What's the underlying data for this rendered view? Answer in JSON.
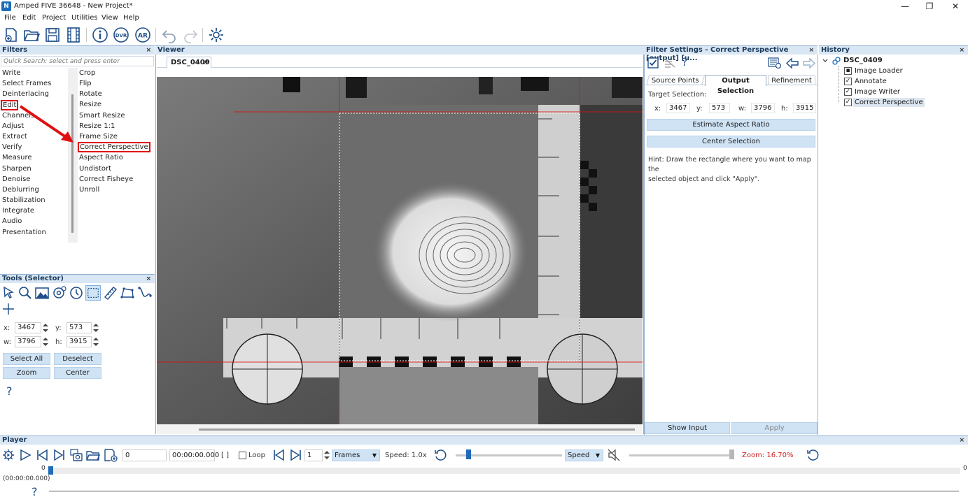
{
  "window": {
    "title": "Amped FIVE 36648 - New Project*",
    "logo_text": "N",
    "minimize": "—",
    "restore": "❐",
    "close": "✕"
  },
  "menu": [
    "File",
    "Edit",
    "Project",
    "Utilities",
    "View",
    "Help"
  ],
  "toolbar_icons": [
    "new-project-icon",
    "open-folder-icon",
    "save-icon",
    "film-icon",
    "info-icon",
    "dvr-icon",
    "ar-icon",
    "undo-icon",
    "redo-icon",
    "settings-icon"
  ],
  "filters": {
    "title": "Filters",
    "close": "×",
    "search_placeholder": "Quick Search: select and press enter",
    "categories": [
      "Write",
      "Select Frames",
      "Deinterlacing",
      "Edit",
      "Channels",
      "Adjust",
      "Extract",
      "Verify",
      "Measure",
      "Sharpen",
      "Denoise",
      "Deblurring",
      "Stabilization",
      "Integrate",
      "Audio",
      "Presentation"
    ],
    "items": [
      "Crop",
      "Flip",
      "Rotate",
      "Resize",
      "Smart Resize",
      "Resize 1:1",
      "Frame Size",
      "Correct Perspective",
      "Aspect Ratio",
      "Undistort",
      "Correct Fisheye",
      "Unroll"
    ]
  },
  "tools": {
    "title": "Tools (Selector)",
    "close": "×",
    "icons": [
      "pointer-icon",
      "zoom-icon",
      "image-icon",
      "target-icon",
      "clock-icon",
      "rect-select-icon",
      "ruler-icon",
      "polygon-icon",
      "curve-icon",
      "crosshair-icon"
    ],
    "x_label": "x:",
    "x_value": "3467",
    "y_label": "y:",
    "y_value": "573",
    "w_label": "w:",
    "w_value": "3796",
    "h_label": "h:",
    "h_value": "3915",
    "select_all": "Select All",
    "deselect": "Deselect",
    "zoom": "Zoom",
    "center": "Center",
    "help": "?"
  },
  "viewer": {
    "title": "Viewer",
    "tab": "DSC_0409",
    "tab_close": "×"
  },
  "filter_settings": {
    "title": "Filter Settings - Correct Perspective [output] [u...",
    "close": "×",
    "help": "?",
    "tabs": [
      "Source Points",
      "Output Selection",
      "Refinement"
    ],
    "target_selection": "Target Selection:",
    "x_label": "x:",
    "x_value": "3467",
    "y_label": "y:",
    "y_value": "573",
    "w_label": "w:",
    "w_value": "3796",
    "h_label": "h:",
    "h_value": "3915",
    "estimate_aspect_ratio": "Estimate Aspect Ratio",
    "center_selection": "Center Selection",
    "hint_line1": "Hint: Draw the rectangle where you want to map the",
    "hint_line2": "selected object and click \"Apply\".",
    "show_input": "Show Input",
    "apply": "Apply"
  },
  "history": {
    "title": "History",
    "close": "×",
    "root": "DSC_0409",
    "items": [
      "Image Loader",
      "Annotate",
      "Image Writer",
      "Correct Perspective"
    ]
  },
  "player": {
    "title": "Player",
    "close": "×",
    "frame_value": "0",
    "time_value": "00:00:00.000",
    "brackets": "[ ]",
    "loop": "Loop",
    "step_value": "1",
    "frames_select": "Frames",
    "speed_label": "Speed: 1.0x",
    "speed_select": "Speed",
    "zoom": "Zoom: 16.70%",
    "timeline_start": "0",
    "timeline_end": "0",
    "time_display": "(00:00:00.000)",
    "help": "?",
    "colors": {
      "zoom_text": "#d02020",
      "accent": "#1f6db8",
      "highlight_red": "#e01010"
    }
  }
}
